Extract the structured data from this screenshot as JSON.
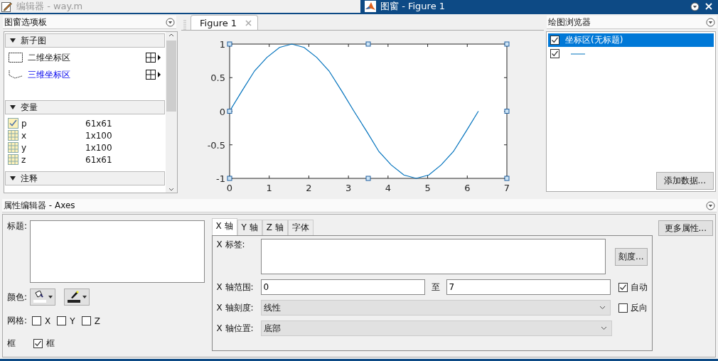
{
  "editor_window": {
    "title": "编辑器 - way.m"
  },
  "figure_window": {
    "title": "图窗 - Figure 1"
  },
  "figure_palette": {
    "title": "图窗选项板",
    "sections": [
      {
        "title": "新子图",
        "expanded": true,
        "kind": "subplots",
        "items": [
          {
            "label": "二维坐标区",
            "highlighted": false,
            "kind": "flat"
          },
          {
            "label": "三维坐标区",
            "highlighted": true,
            "kind": "spatial"
          }
        ]
      },
      {
        "title": "变量",
        "expanded": true,
        "kind": "variables",
        "items": [
          {
            "name": "p",
            "size": "61x61",
            "plotted": true
          },
          {
            "name": "x",
            "size": "1x100",
            "plotted": false
          },
          {
            "name": "y",
            "size": "1x100",
            "plotted": false
          },
          {
            "name": "z",
            "size": "61x61",
            "plotted": false
          }
        ]
      },
      {
        "title": "注释",
        "expanded": true,
        "kind": "annotations"
      }
    ]
  },
  "figure_tabs": [
    {
      "label": "Figure 1",
      "selected": true
    }
  ],
  "chart_data": {
    "type": "line",
    "xlim": [
      0,
      7
    ],
    "ylim": [
      -1,
      1
    ],
    "xticks": [
      0,
      1,
      2,
      3,
      4,
      5,
      6,
      7
    ],
    "yticks": [
      -1,
      -0.5,
      0,
      0.5,
      1
    ],
    "x": [
      0,
      0.31,
      0.63,
      0.94,
      1.26,
      1.57,
      1.88,
      2.2,
      2.51,
      2.83,
      3.14,
      3.46,
      3.77,
      4.08,
      4.4,
      4.71,
      5.03,
      5.34,
      5.65,
      5.97,
      6.28
    ],
    "series": [
      {
        "color": "#0072bd",
        "values": [
          0,
          0.3,
          0.6,
          0.8,
          0.95,
          1,
          0.95,
          0.8,
          0.6,
          0.3,
          0,
          -0.3,
          -0.6,
          -0.8,
          -0.95,
          -1,
          -0.95,
          -0.8,
          -0.6,
          -0.3,
          0
        ]
      }
    ]
  },
  "plot_browser": {
    "title": "绘图浏览器",
    "items": [
      {
        "kind": "axes",
        "label": "坐标区(无标题)",
        "checked": true,
        "selected": true
      },
      {
        "kind": "line",
        "checked": true,
        "selected": false
      }
    ],
    "button": "添加数据..."
  },
  "property_editor": {
    "title": "属性编辑器 - Axes",
    "title_label": "标题:",
    "color_label": "颜色:",
    "grid_label": "网格:",
    "grid": [
      {
        "label": "X",
        "checked": false
      },
      {
        "label": "Y",
        "checked": false
      },
      {
        "label": "Z",
        "checked": false
      }
    ],
    "box_label": "框",
    "box": {
      "label": "框",
      "checked": true
    },
    "tabs": [
      {
        "label": "X 轴",
        "selected": true
      },
      {
        "label": "Y 轴",
        "selected": false
      },
      {
        "label": "Z 轴",
        "selected": false
      },
      {
        "label": "字体",
        "selected": false
      }
    ],
    "axis_label": "X 标签:",
    "ticks_button": "刻度...",
    "limits_label": "X 轴范围:",
    "limit_from": "0",
    "to_label": "至",
    "limit_to": "7",
    "auto": {
      "label": "自动",
      "checked": true
    },
    "scale_label": "X 轴刻度:",
    "scale": "线性",
    "reverse": {
      "label": "反向",
      "checked": false
    },
    "location_label": "X 轴位置:",
    "location": "底部",
    "more_button": "更多属性..."
  }
}
